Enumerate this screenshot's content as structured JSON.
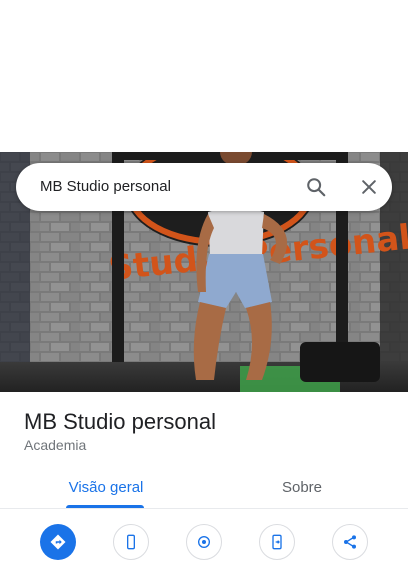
{
  "search": {
    "query": "MB Studio personal",
    "search_icon": "search-icon",
    "close_icon": "close-icon"
  },
  "photo": {
    "sign_text": "Studio Personal"
  },
  "place": {
    "name": "MB Studio personal",
    "category": "Academia"
  },
  "tabs": [
    {
      "label": "Visão geral",
      "active": true
    },
    {
      "label": "Sobre",
      "active": false
    }
  ],
  "actions": [
    {
      "icon": "directions-icon"
    },
    {
      "icon": "phone-icon"
    },
    {
      "icon": "nearby-icon"
    },
    {
      "icon": "send-to-phone-icon"
    },
    {
      "icon": "share-icon"
    }
  ],
  "colors": {
    "accent": "#1a73e8",
    "title": "#202124",
    "subtitle": "#70757a"
  }
}
